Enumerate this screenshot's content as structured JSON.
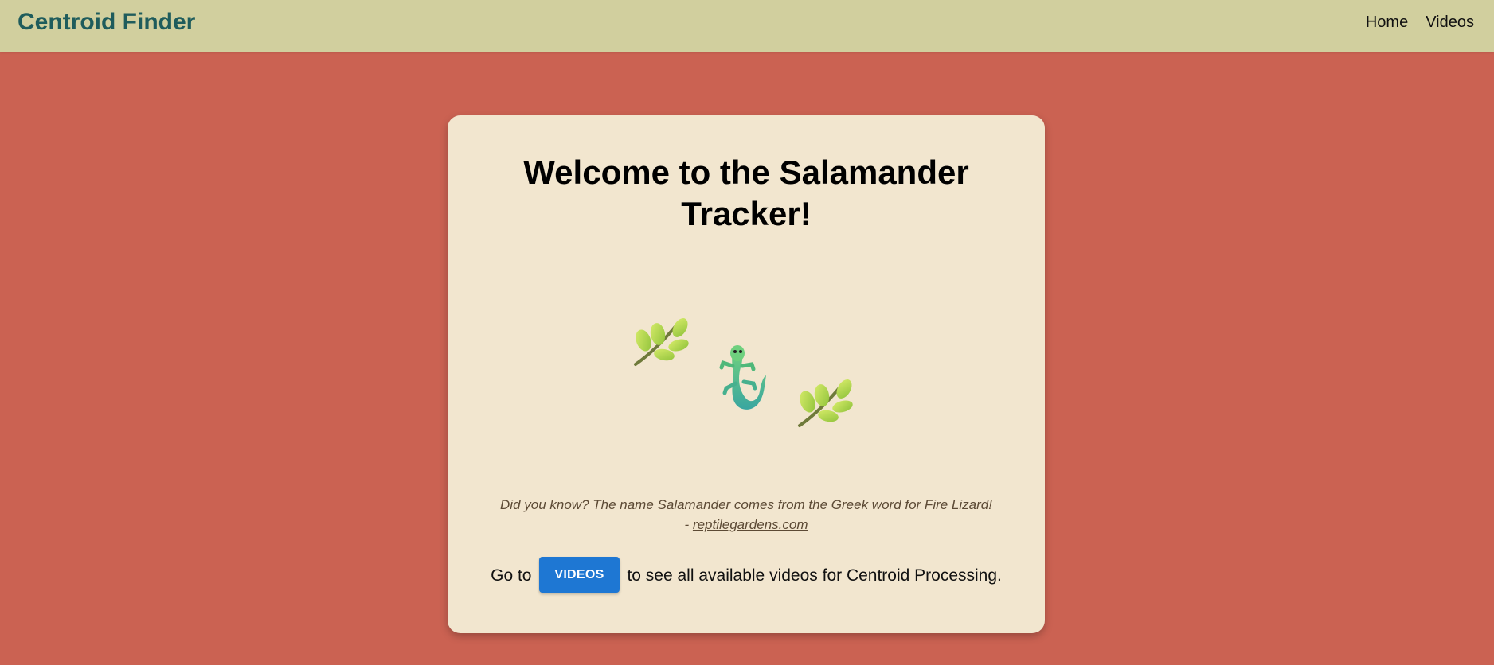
{
  "header": {
    "brand": "Centroid Finder",
    "nav": [
      {
        "label": "Home"
      },
      {
        "label": "Videos"
      }
    ]
  },
  "main": {
    "title_line1": "Welcome to the Salamander",
    "title_line2": "Tracker!",
    "illustration": {
      "icons": [
        "leaf-branch-icon",
        "salamander-icon",
        "leaf-branch-icon"
      ]
    },
    "fact_text": "Did you know? The name Salamander comes from the Greek word for Fire Lizard!",
    "fact_dash": "-",
    "fact_source": "reptilegardens.com",
    "cta_prefix": "Go to",
    "cta_button": "VIDEOS",
    "cta_suffix": "to see all available videos for Centroid Processing."
  },
  "colors": {
    "background": "#cb6252",
    "header": "#d1cf9e",
    "brand": "#1f5c5c",
    "card": "#f2e6cf",
    "button": "#1e77d3"
  }
}
